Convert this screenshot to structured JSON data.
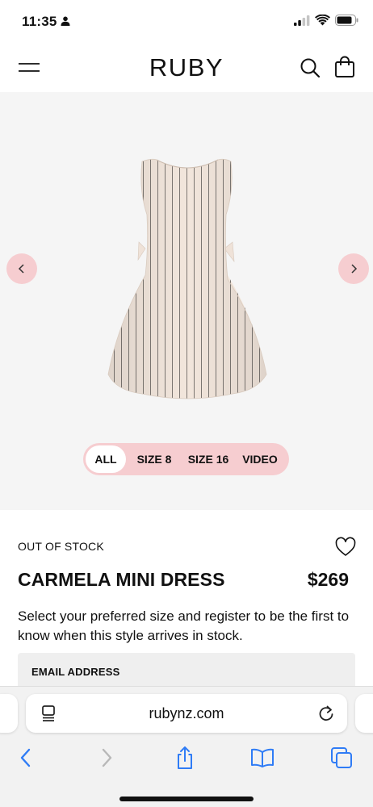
{
  "status_bar": {
    "time": "11:35"
  },
  "header": {
    "brand": "RUBY"
  },
  "gallery": {
    "product_image": "striped sleeveless mini dress",
    "tabs": [
      {
        "label": "ALL",
        "active": true
      },
      {
        "label": "SIZE 8",
        "active": false
      },
      {
        "label": "SIZE 16",
        "active": false
      },
      {
        "label": "VIDEO",
        "active": false
      }
    ]
  },
  "product": {
    "stock_status": "OUT OF STOCK",
    "name": "CARMELA MINI DRESS",
    "price": "$269",
    "notify_text": "Select your preferred size and register to be the first to know when this style arrives in stock.",
    "email_label": "EMAIL ADDRESS"
  },
  "browser": {
    "url": "rubynz.com"
  },
  "colors": {
    "accent_pink": "#f6cdd0",
    "safari_blue": "#2f7cf6",
    "gallery_bg": "#f5f5f5"
  }
}
